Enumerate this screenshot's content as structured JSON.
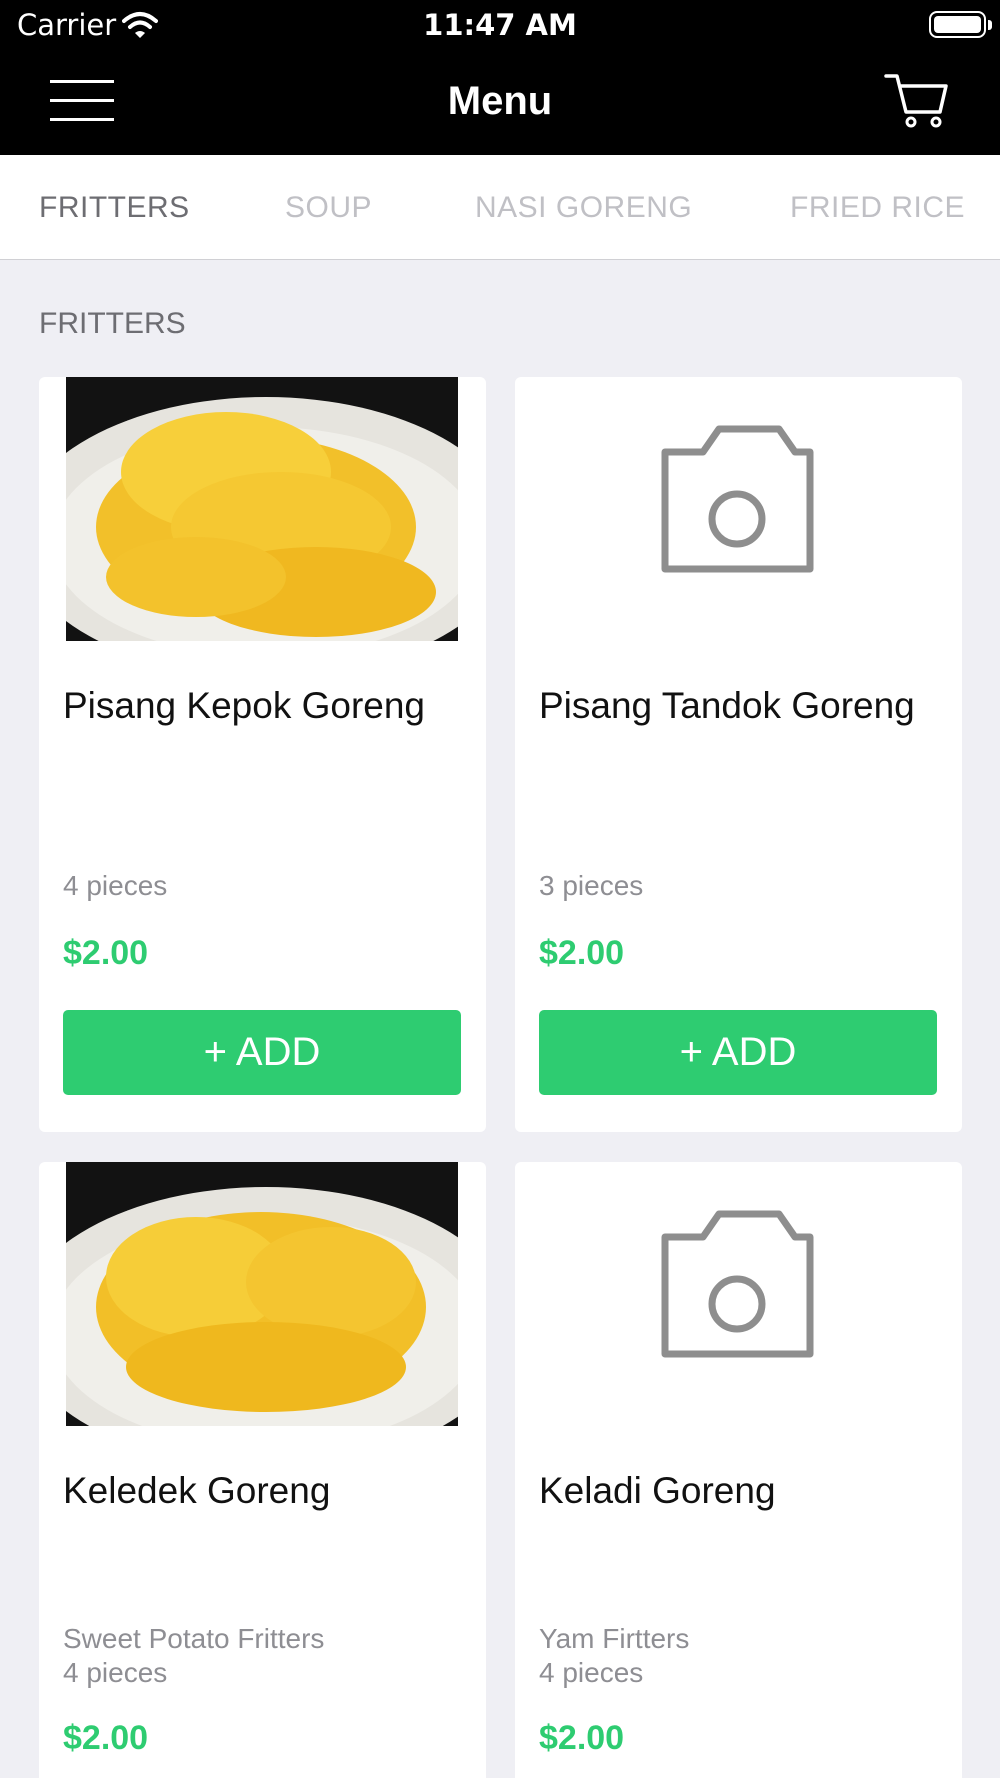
{
  "status_bar": {
    "carrier": "Carrier",
    "time": "11:47 AM"
  },
  "nav": {
    "title": "Menu"
  },
  "tabs": [
    {
      "label": "FRITTERS",
      "active": true
    },
    {
      "label": "SOUP",
      "active": false
    },
    {
      "label": "NASI GORENG",
      "active": false
    },
    {
      "label": "FRIED RICE",
      "active": false
    }
  ],
  "section": {
    "title": "FRITTERS"
  },
  "products": [
    {
      "name": "Pisang Kepok Goreng",
      "description": "4 pieces",
      "price": "$2.00",
      "add_label": "+ ADD",
      "image": "fritter-photo"
    },
    {
      "name": "Pisang Tandok Goreng",
      "description": "3 pieces",
      "price": "$2.00",
      "add_label": "+ ADD",
      "image": "camera-placeholder"
    },
    {
      "name": "Keledek Goreng",
      "description_line1": "Sweet Potato Fritters",
      "description_line2": "4 pieces",
      "price": "$2.00",
      "image": "fritter-photo"
    },
    {
      "name": "Keladi Goreng",
      "description_line1": "Yam Firtters",
      "description_line2": "4 pieces",
      "price": "$2.00",
      "image": "camera-placeholder"
    }
  ],
  "colors": {
    "accent": "#2ecc71",
    "nav_bg": "#000000",
    "background": "#efeff4"
  }
}
